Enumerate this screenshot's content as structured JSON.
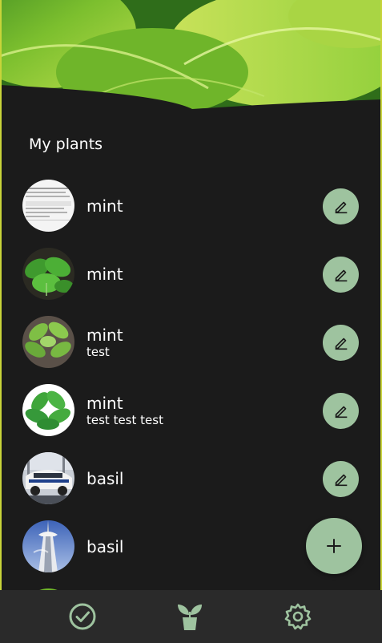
{
  "header": {
    "image": "leaf-header-image"
  },
  "page": {
    "title": "My plants"
  },
  "plants": [
    {
      "name": "mint",
      "note": "",
      "thumb": "document-photo"
    },
    {
      "name": "mint",
      "note": "",
      "thumb": "mint-photo"
    },
    {
      "name": "mint",
      "note": "test",
      "thumb": "mint-photo"
    },
    {
      "name": "mint",
      "note": "test test test",
      "thumb": "mint-photo"
    },
    {
      "name": "basil",
      "note": "",
      "thumb": "car-photo"
    },
    {
      "name": "basil",
      "note": "",
      "thumb": "tower-photo"
    }
  ],
  "actions": {
    "edit_icon": "pencil-icon",
    "add_icon": "plus-icon"
  },
  "nav": {
    "items": [
      {
        "name": "tasks",
        "icon": "check-circle-icon"
      },
      {
        "name": "plants",
        "icon": "sprout-pot-icon"
      },
      {
        "name": "settings",
        "icon": "gear-icon"
      }
    ]
  },
  "colors": {
    "background": "#1b1b1b",
    "accent": "#9ec39f",
    "nav_background": "#2a2a2a",
    "text": "#ffffff"
  }
}
